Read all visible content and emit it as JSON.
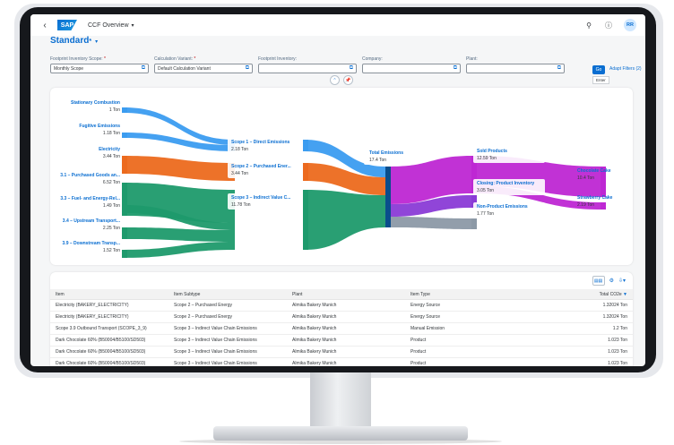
{
  "shell": {
    "title": "CCF Overview",
    "logo_text": "SAP",
    "avatar_initials": "RR"
  },
  "header": {
    "variant_title": "Standard",
    "variant_suffix": "*"
  },
  "filters": [
    {
      "label": "Footprint Inventory Scope:",
      "required": true,
      "value": "Monthly Scope"
    },
    {
      "label": "Calculation Variant:",
      "required": true,
      "value": "Default Calculation Variant"
    },
    {
      "label": "Footprint Inventory:",
      "required": false,
      "value": ""
    },
    {
      "label": "Company:",
      "required": false,
      "value": ""
    },
    {
      "label": "Plant:",
      "required": false,
      "value": ""
    }
  ],
  "actions": {
    "go_label": "Go",
    "adapt_filters_label": "Adapt Filters (2)",
    "tooltip": "Enter"
  },
  "sankey": {
    "sources": [
      {
        "name": "Stationary Combustion",
        "value": "1 Ton"
      },
      {
        "name": "Fugitive Emissions",
        "value": "1.18 Ton"
      },
      {
        "name": "Electricity",
        "value": "3.44 Ton"
      },
      {
        "name": "3.1 – Purchased Goods an...",
        "value": "6.52 Ton"
      },
      {
        "name": "3.3 – Fuel- and Energy-Rel...",
        "value": "1.49 Ton"
      },
      {
        "name": "3.4 – Upstream Transport...",
        "value": "2.25 Ton"
      },
      {
        "name": "3.9 – Downstream Transp...",
        "value": "1.52 Ton"
      }
    ],
    "scopes": [
      {
        "name": "Scope 1 – Direct Emissions",
        "value": "2.18 Ton"
      },
      {
        "name": "Scope 2 – Purchased Ener...",
        "value": "3.44 Ton"
      },
      {
        "name": "Scope 3 – Indirect Value C...",
        "value": "11.78 Ton"
      }
    ],
    "total": {
      "name": "Total Emissions",
      "value": "17.4 Ton"
    },
    "outputs": [
      {
        "name": "Sold Products",
        "value": "12.59 Ton"
      },
      {
        "name": "Closing: Product Inventory",
        "value": "3.05 Ton"
      },
      {
        "name": "Non-Product Emissions",
        "value": "1.77 Ton"
      }
    ],
    "products": [
      {
        "name": "Chocolate Cake",
        "value": "10.4 Ton"
      },
      {
        "name": "Strawberry Cake",
        "value": "2.19 Ton"
      }
    ],
    "colors": {
      "scope1": "#3b9cf0",
      "scope2": "#ec6a1e",
      "scope3": "#1e9a6c",
      "total": "#be27d3",
      "inventory": "#8a3bd6",
      "nonproduct": "#8c99a6",
      "node": "#0a4d8c"
    }
  },
  "table": {
    "columns": [
      "Item",
      "Item Subtype",
      "Plant",
      "Item Type",
      "Total CO2e"
    ],
    "rows": [
      [
        "Electricity (BAKERY_ELECTRICITY)",
        "Scope 2 – Purchased Energy",
        "Almika Bakery Munich",
        "Energy Source",
        "1.32024 Ton"
      ],
      [
        "Electricity (BAKERY_ELECTRICITY)",
        "Scope 2 – Purchased Energy",
        "Almika Bakery Munich",
        "Energy Source",
        "1.32024 Ton"
      ],
      [
        "Scope 3.9 Outbound Transport (SCOPE_3_9)",
        "Scope 3 – Indirect Value Chain Emissions",
        "Almika Bakery Munich",
        "Manual Emission",
        "1.2 Ton"
      ],
      [
        "Dark Chocolate 60% (B50004/B5100/SD503)",
        "Scope 3 – Indirect Value Chain Emissions",
        "Almika Bakery Munich",
        "Product",
        "1.023 Ton"
      ],
      [
        "Dark Chocolate 60% (B50004/B5100/SD503)",
        "Scope 3 – Indirect Value Chain Emissions",
        "Almika Bakery Munich",
        "Product",
        "1.023 Ton"
      ],
      [
        "Dark Chocolate 60% (B50004/B5100/SD503)",
        "Scope 3 – Indirect Value Chain Emissions",
        "Almika Bakery Munich",
        "Product",
        "1.023 Ton"
      ]
    ]
  }
}
